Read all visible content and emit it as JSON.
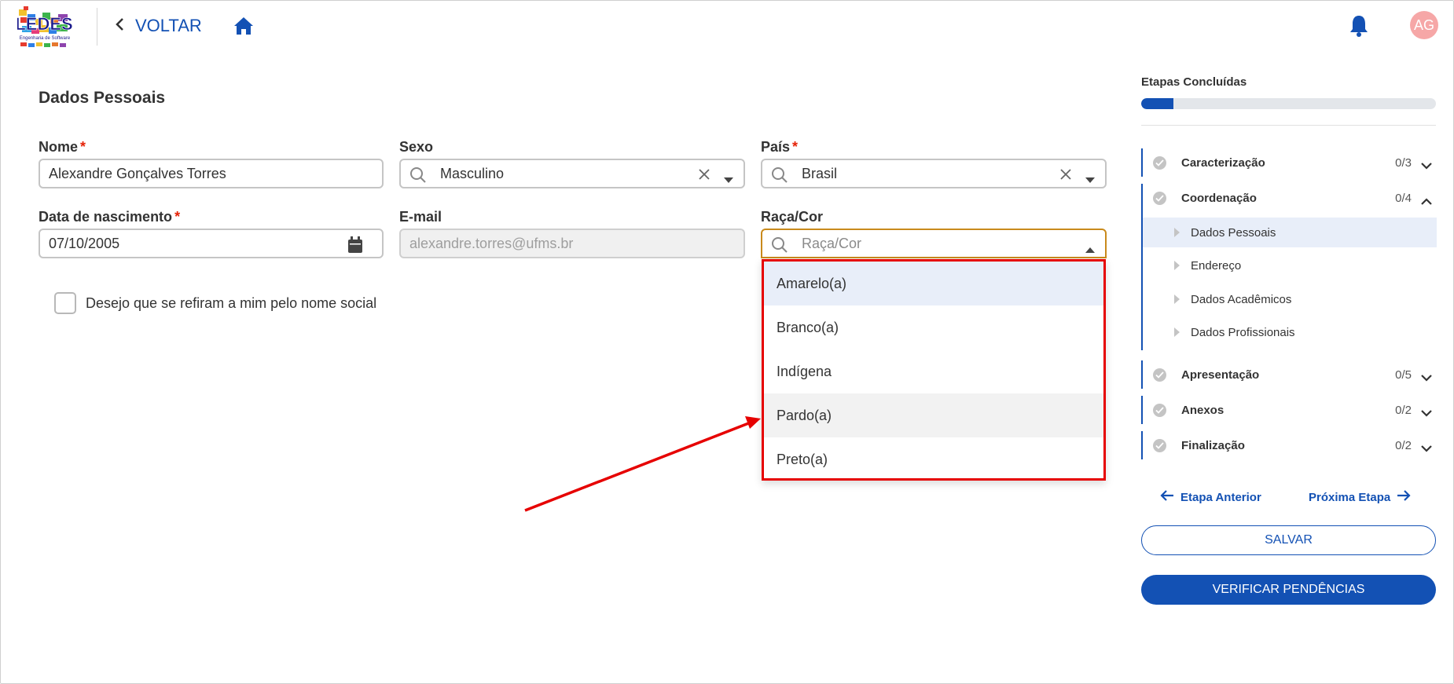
{
  "header": {
    "logo_text": "LEDES",
    "logo_subtext": "Engenharia de Software",
    "back_label": "VOLTAR",
    "avatar_initials": "AG",
    "icons": [
      "home-icon",
      "bell-icon",
      "chevron-left-icon"
    ]
  },
  "form": {
    "title": "Dados Pessoais",
    "nome": {
      "label": "Nome",
      "value": "Alexandre Gonçalves Torres",
      "required": true
    },
    "sexo": {
      "label": "Sexo",
      "value": "Masculino"
    },
    "pais": {
      "label": "País",
      "value": "Brasil",
      "required": true
    },
    "nascimento": {
      "label": "Data de nascimento",
      "value": "07/10/2005",
      "required": true
    },
    "email": {
      "label": "E-mail",
      "value": "alexandre.torres@ufms.br"
    },
    "raca": {
      "label": "Raça/Cor",
      "placeholder": "Raça/Cor"
    },
    "required_mark": "*",
    "nome_social_label": "Desejo que se refiram a mim pelo nome social"
  },
  "dropdown": {
    "options": [
      "Amarelo(a)",
      "Branco(a)",
      "Indígena",
      "Pardo(a)",
      "Preto(a)"
    ],
    "highlighted": "Amarelo(a)",
    "hovered": "Pardo(a)"
  },
  "sidebar": {
    "title": "Etapas Concluídas",
    "progress_fraction": 0.11,
    "steps": [
      {
        "label": "Caracterização",
        "count": "0/3"
      },
      {
        "label": "Coordenação",
        "count": "0/4"
      },
      {
        "label": "Apresentação",
        "count": "0/5"
      },
      {
        "label": "Anexos",
        "count": "0/2"
      },
      {
        "label": "Finalização",
        "count": "0/2"
      }
    ],
    "substeps": [
      "Dados Pessoais",
      "Endereço",
      "Dados Acadêmicos",
      "Dados Profissionais"
    ],
    "prev_label": "Etapa Anterior",
    "next_label": "Próxima Etapa",
    "save_label": "SALVAR",
    "verify_label": "VERIFICAR PENDÊNCIAS"
  },
  "colors": {
    "primary": "#1351b4",
    "required": "#e52207",
    "highlight_box": "#e60000",
    "focus_border": "#c98a1c",
    "avatar_bg": "#f6a7a7"
  }
}
